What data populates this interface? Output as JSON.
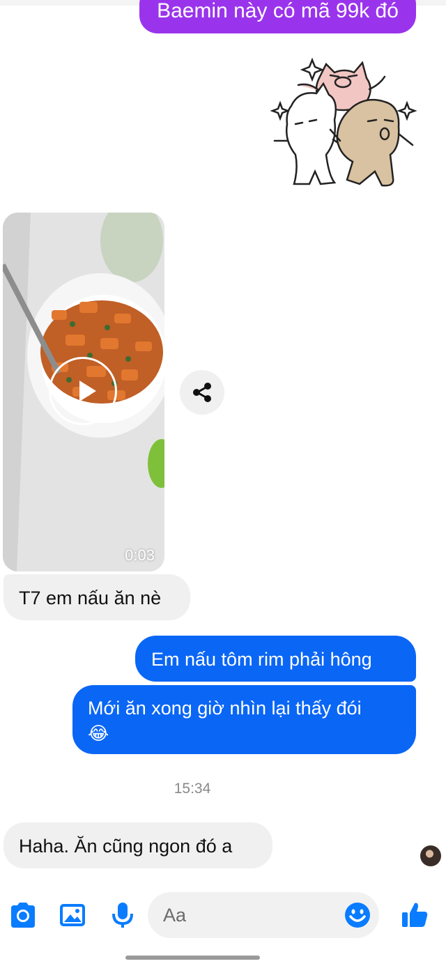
{
  "messages": {
    "outgoing_top": "Baemin này có mã 99k đó",
    "video_duration": "0:03",
    "incoming_1": "T7 em nấu ăn nè",
    "outgoing_1": "Em nấu tôm rim phải hông",
    "outgoing_2": "Mới ăn xong giờ nhìn lại thấy đói",
    "outgoing_2_emoji": "😂",
    "timestamp": "15:34",
    "incoming_2": "Haha. Ăn cũng ngon đó a"
  },
  "composer": {
    "placeholder": "Aa"
  },
  "colors": {
    "outgoing_bubble": "#0a66f5",
    "sticker_bubble": "#9a34ec",
    "incoming_bubble": "#f0f0f0",
    "accent": "#0a7cff"
  },
  "icons": [
    "camera-icon",
    "gallery-icon",
    "microphone-icon",
    "emoji-icon",
    "like-icon",
    "share-icon",
    "play-icon"
  ]
}
